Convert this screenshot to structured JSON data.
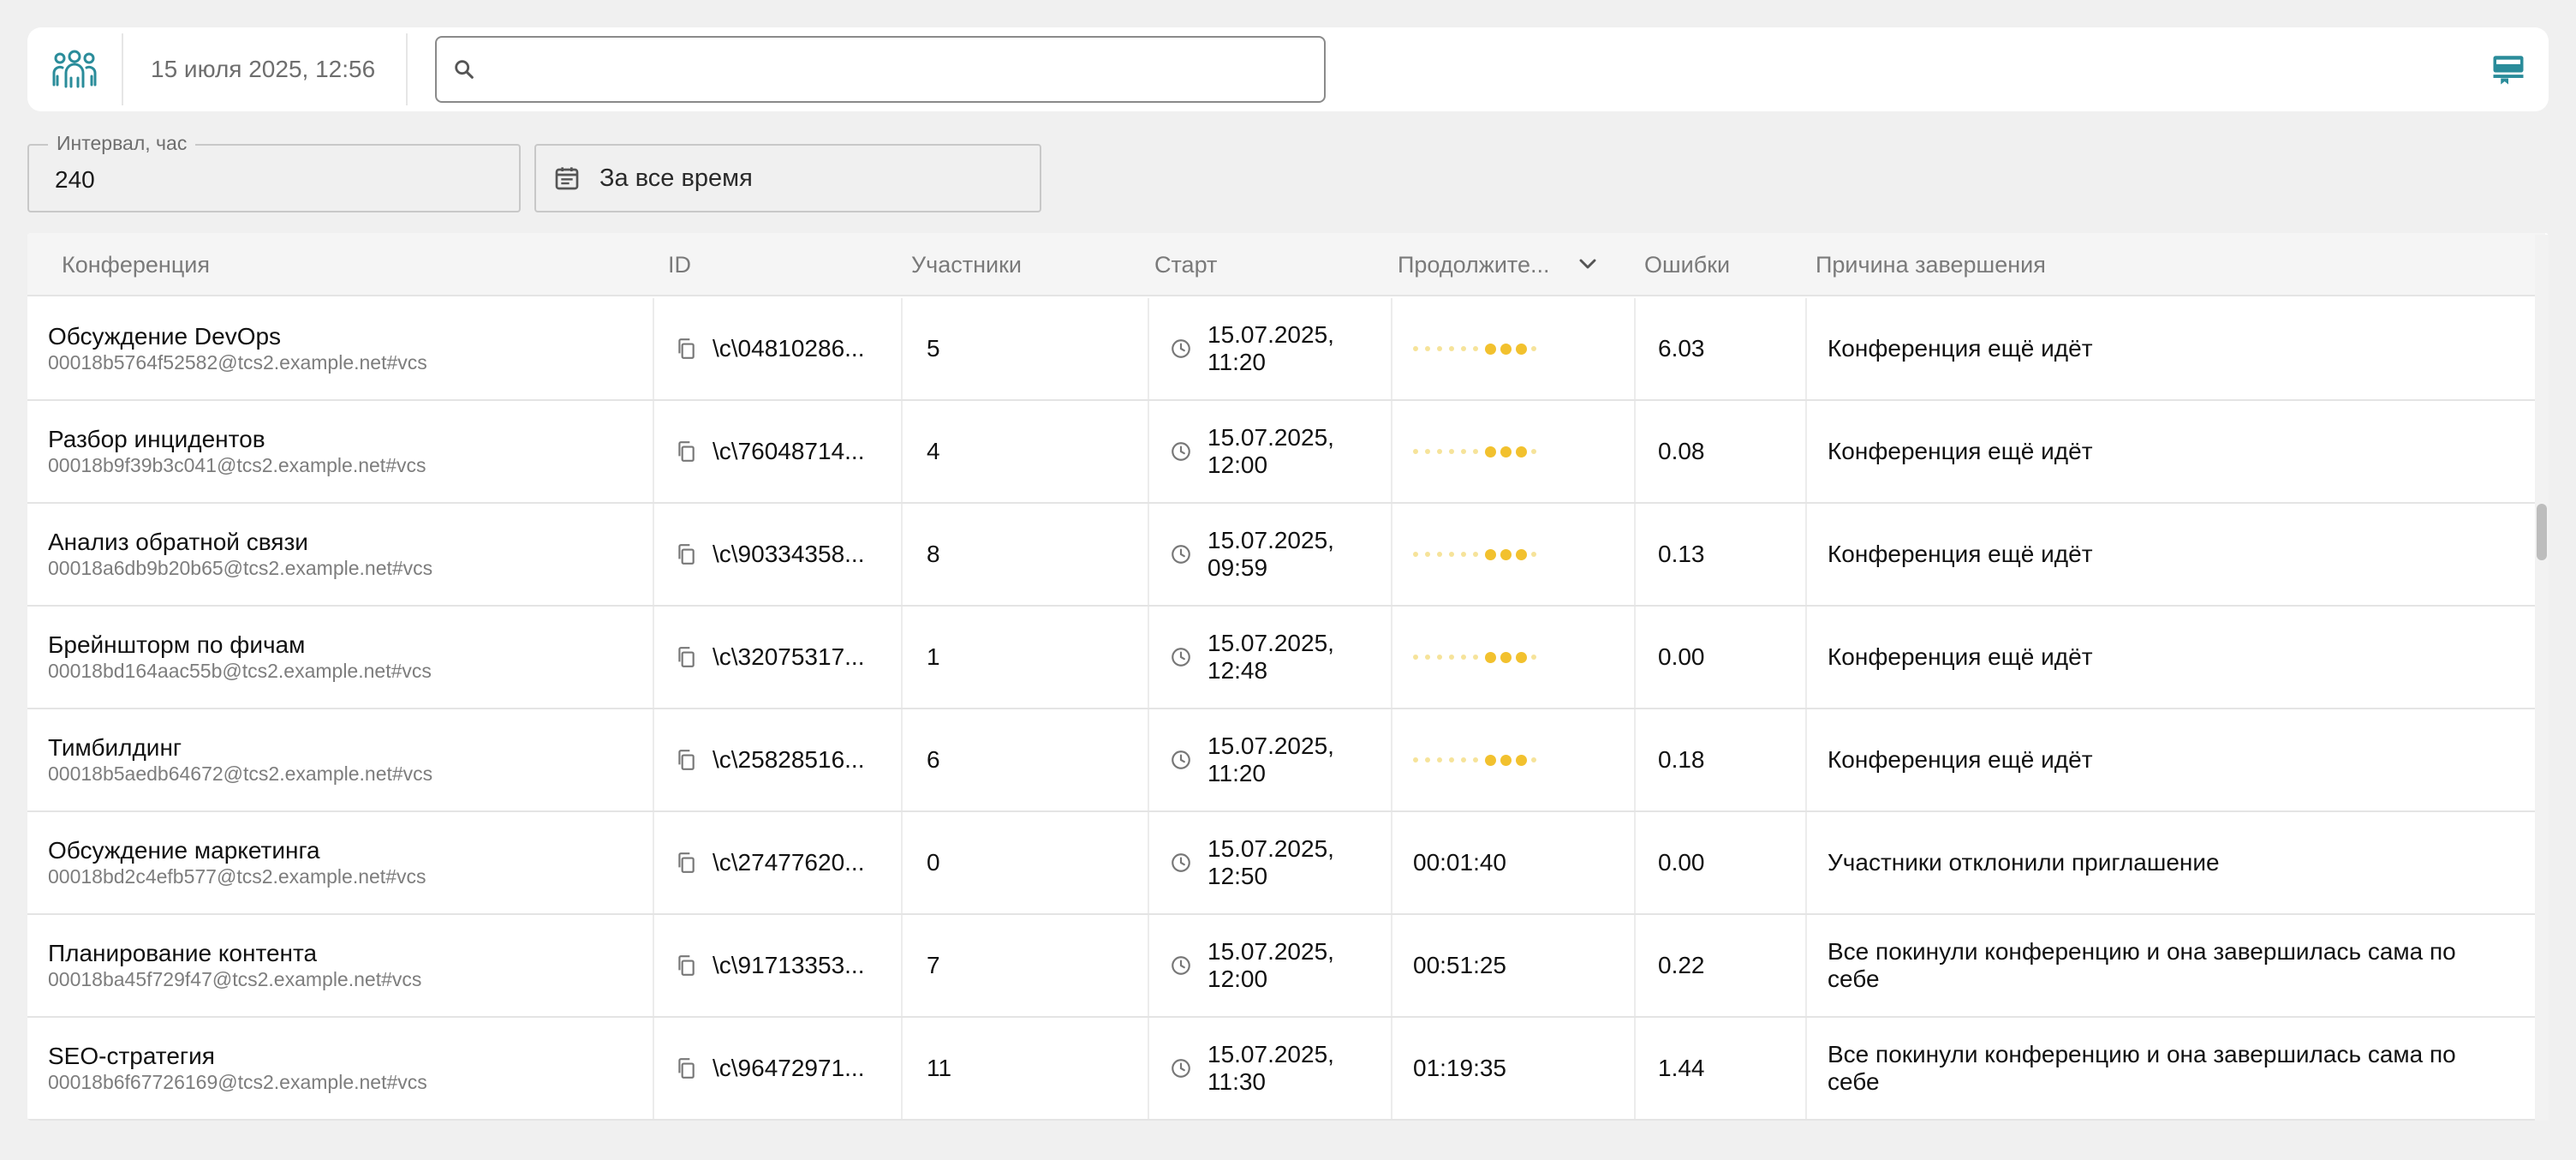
{
  "header": {
    "datetime": "15 июля 2025, 12:56",
    "search_placeholder": ""
  },
  "filters": {
    "interval_label": "Интервал, час",
    "interval_value": "240",
    "period_label": "За все время"
  },
  "table": {
    "columns": {
      "conference": "Конференция",
      "id": "ID",
      "participants": "Участники",
      "start": "Старт",
      "duration": "Продолжите...",
      "errors": "Ошибки",
      "reason": "Причина завершения"
    },
    "rows": [
      {
        "name": "Обсуждение DevOps",
        "address": "00018b5764f52582@tcs2.example.net#vcs",
        "id": "\\c\\04810286...",
        "participants": "5",
        "start_date": "15.07.2025,",
        "start_time": "11:20",
        "duration": "",
        "errors": "6.03",
        "reason": "Конференция ещё идёт"
      },
      {
        "name": "Разбор инцидентов",
        "address": "00018b9f39b3c041@tcs2.example.net#vcs",
        "id": "\\c\\76048714...",
        "participants": "4",
        "start_date": "15.07.2025,",
        "start_time": "12:00",
        "duration": "",
        "errors": "0.08",
        "reason": "Конференция ещё идёт"
      },
      {
        "name": "Анализ обратной связи",
        "address": "00018a6db9b20b65@tcs2.example.net#vcs",
        "id": "\\c\\90334358...",
        "participants": "8",
        "start_date": "15.07.2025,",
        "start_time": "09:59",
        "duration": "",
        "errors": "0.13",
        "reason": "Конференция ещё идёт"
      },
      {
        "name": "Брейншторм по фичам",
        "address": "00018bd164aac55b@tcs2.example.net#vcs",
        "id": "\\c\\32075317...",
        "participants": "1",
        "start_date": "15.07.2025,",
        "start_time": "12:48",
        "duration": "",
        "errors": "0.00",
        "reason": "Конференция ещё идёт"
      },
      {
        "name": "Тимбилдинг",
        "address": "00018b5aedb64672@tcs2.example.net#vcs",
        "id": "\\c\\25828516...",
        "participants": "6",
        "start_date": "15.07.2025,",
        "start_time": "11:20",
        "duration": "",
        "errors": "0.18",
        "reason": "Конференция ещё идёт"
      },
      {
        "name": "Обсуждение маркетинга",
        "address": "00018bd2c4efb577@tcs2.example.net#vcs",
        "id": "\\c\\27477620...",
        "participants": "0",
        "start_date": "15.07.2025,",
        "start_time": "12:50",
        "duration": "00:01:40",
        "errors": "0.00",
        "reason": "Участники отклонили приглашение"
      },
      {
        "name": "Планирование контента",
        "address": "00018ba45f729f47@tcs2.example.net#vcs",
        "id": "\\c\\91713353...",
        "participants": "7",
        "start_date": "15.07.2025,",
        "start_time": "12:00",
        "duration": "00:51:25",
        "errors": "0.22",
        "reason": "Все покинули конференцию и она завершилась сама по себе"
      },
      {
        "name": "SEO-стратегия",
        "address": "00018b6f67726169@tcs2.example.net#vcs",
        "id": "\\c\\96472971...",
        "participants": "11",
        "start_date": "15.07.2025,",
        "start_time": "11:30",
        "duration": "01:19:35",
        "errors": "1.44",
        "reason": "Все покинули конференцию и она завершилась сама по себе"
      }
    ]
  },
  "icons": {
    "logo": "people-group-icon",
    "search": "search-icon",
    "panel": "panel-toggle-icon",
    "calendar": "calendar-icon",
    "copy": "copy-icon",
    "clock": "clock-icon",
    "sort": "chevron-down-icon",
    "duration_in_progress": "in-progress-dots-icon"
  },
  "colors": {
    "accent": "#2a8c9a",
    "progress_dots": "#f2c12e"
  }
}
